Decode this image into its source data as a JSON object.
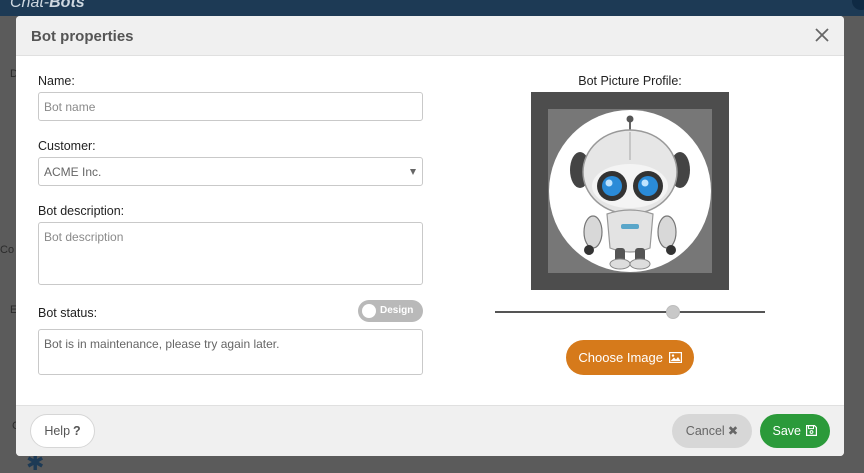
{
  "app": {
    "logo_prefix": "Chat-",
    "logo_bold": "Bots",
    "bg_fragments": [
      "D",
      "Co",
      "E",
      "C"
    ]
  },
  "modal": {
    "title": "Bot properties",
    "close_icon": "close-icon"
  },
  "form": {
    "name_label": "Name:",
    "name_placeholder": "Bot name",
    "customer_label": "Customer:",
    "customer_value": "ACME Inc.",
    "description_label": "Bot description:",
    "description_placeholder": "Bot description",
    "status_label": "Bot status:",
    "status_toggle_label": "Design",
    "status_message": "Bot is in maintenance, please try again later."
  },
  "picture": {
    "label": "Bot Picture Profile:",
    "zoom_level": 0.66,
    "choose_label": "Choose Image",
    "choose_icon": "image-icon"
  },
  "footer": {
    "help_label": "Help",
    "help_icon": "question-icon",
    "cancel_label": "Cancel",
    "cancel_icon": "times-icon",
    "save_label": "Save",
    "save_icon": "floppy-disk-icon"
  },
  "colors": {
    "accent_orange": "#d67a1b",
    "save_green": "#2b9a3a",
    "topbar_navy": "#1d3a55"
  }
}
